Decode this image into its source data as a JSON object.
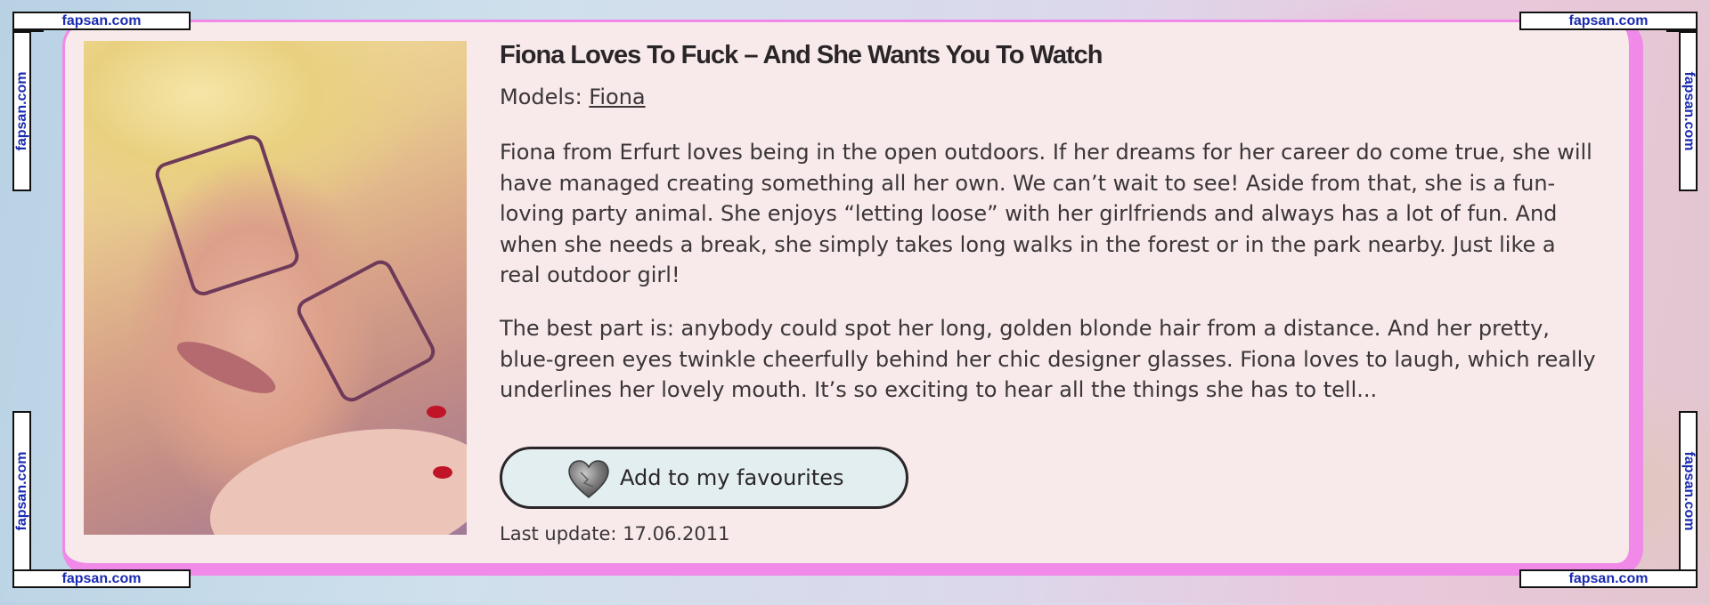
{
  "watermark": {
    "text": "fapsan.com"
  },
  "model_card": {
    "title": "Fiona Loves To Fuck – And She Wants You To Watch",
    "models_label": "Models:",
    "model_name": "Fiona",
    "description": [
      "Fiona from Erfurt loves being in the open outdoors. If her dreams for her career do come true, she will have managed creating something all her own. We can’t wait to see! Aside from that, she is a fun-loving party animal. She enjoys “letting loose” with her girlfriends and always has a lot of fun. And when she needs a break, she simply takes long walks in the forest or in the park nearby. Just like a real outdoor girl!",
      "The best part is: anybody could spot her long, golden blonde hair from a distance. And her pretty, blue-green eyes twinkle cheerfully behind her chic designer glasses. Fiona loves to laugh, which really underlines her lovely mouth. It’s so exciting to hear all the things she has to tell..."
    ],
    "favourite_button_label": "Add to my favourites",
    "favourite_icon": "heart-icon",
    "last_update_label": "Last update:",
    "last_update": "17.06.2011",
    "colors": {
      "card_border": "#f089e8",
      "card_background": "#f8eaea",
      "button_background": "#e2eef0",
      "watermark_text": "#1a2bb0"
    }
  }
}
